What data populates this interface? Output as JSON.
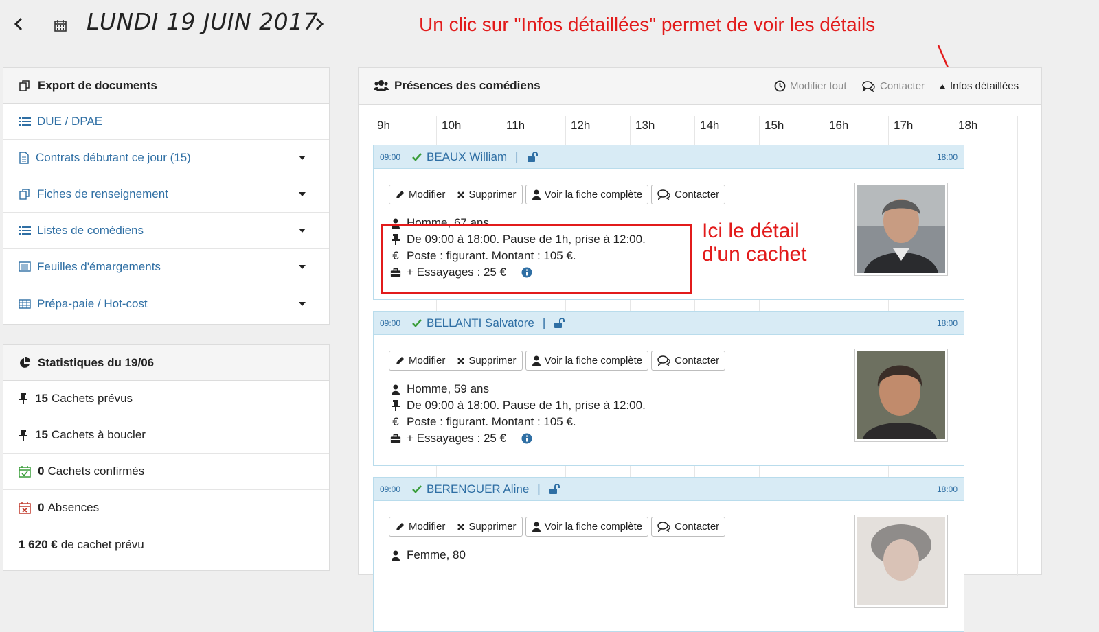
{
  "header": {
    "date_title": "LUNDI 19 JUIN 2017",
    "prev_icon": "chevron-left-icon",
    "next_icon": "chevron-right-icon",
    "calendar_icon": "calendar-icon"
  },
  "annotations": {
    "top": "Un clic sur \"Infos détaillées\" permet de voir les détails",
    "mid_line1": "Ici le détail",
    "mid_line2": "d'un cachet",
    "color": "#e21b1b"
  },
  "export_panel": {
    "title": "Export de documents",
    "items": [
      {
        "label": "DUE / DPAE",
        "icon": "list-icon",
        "dropdown": false
      },
      {
        "label": "Contrats débutant ce jour (15)",
        "icon": "document-icon",
        "dropdown": true
      },
      {
        "label": "Fiches de renseignement",
        "icon": "copy-icon",
        "dropdown": true
      },
      {
        "label": "Listes de comédiens",
        "icon": "list-icon",
        "dropdown": true
      },
      {
        "label": "Feuilles d'émargements",
        "icon": "sheet-icon",
        "dropdown": true
      },
      {
        "label": "Prépa-paie / Hot-cost",
        "icon": "table-icon",
        "dropdown": true
      }
    ]
  },
  "stats_panel": {
    "title": "Statistiques du 19/06",
    "items": [
      {
        "value": "15",
        "label": "Cachets prévus",
        "icon": "pin-icon"
      },
      {
        "value": "15",
        "label": "Cachets à boucler",
        "icon": "pin-icon"
      },
      {
        "value": "0",
        "label": "Cachets confirmés",
        "icon": "calendar-check-icon"
      },
      {
        "value": "0",
        "label": "Absences",
        "icon": "calendar-x-icon"
      },
      {
        "value": "1 620 €",
        "label": "de cachet prévu",
        "icon": ""
      }
    ]
  },
  "main_panel": {
    "title": "Présences des comédiens",
    "actions": {
      "modify_all": "Modifier tout",
      "contact": "Contacter",
      "details": "Infos détaillées"
    },
    "hours": [
      "9h",
      "10h",
      "11h",
      "12h",
      "13h",
      "14h",
      "15h",
      "16h",
      "17h",
      "18h"
    ],
    "buttons": {
      "modify": "Modifier",
      "delete": "Supprimer",
      "view_sheet": "Voir la fiche complète",
      "contact": "Contacter"
    },
    "actors": [
      {
        "start": "09:00",
        "end": "18:00",
        "name": "BEAUX William",
        "sep": "|",
        "gender_age": "Homme, 67 ans",
        "schedule": "De 09:00 à 18:00. Pause de 1h, prise à 12:00.",
        "position": "Poste : figurant. Montant : 105 €.",
        "extra": "+ Essayages : 25 €"
      },
      {
        "start": "09:00",
        "end": "18:00",
        "name": "BELLANTI Salvatore",
        "sep": "|",
        "gender_age": "Homme, 59 ans",
        "schedule": "De 09:00 à 18:00. Pause de 1h, prise à 12:00.",
        "position": "Poste : figurant. Montant : 105 €.",
        "extra": "+ Essayages : 25 €"
      },
      {
        "start": "09:00",
        "end": "18:00",
        "name": "BERENGUER Aline",
        "sep": "|",
        "gender_age": "Femme, 80",
        "schedule": "",
        "position": "",
        "extra": ""
      }
    ]
  },
  "colors": {
    "link": "#2f6fa4",
    "card_header": "#d8ebf5",
    "check": "#3a9d3a",
    "annotation": "#e21b1b"
  }
}
